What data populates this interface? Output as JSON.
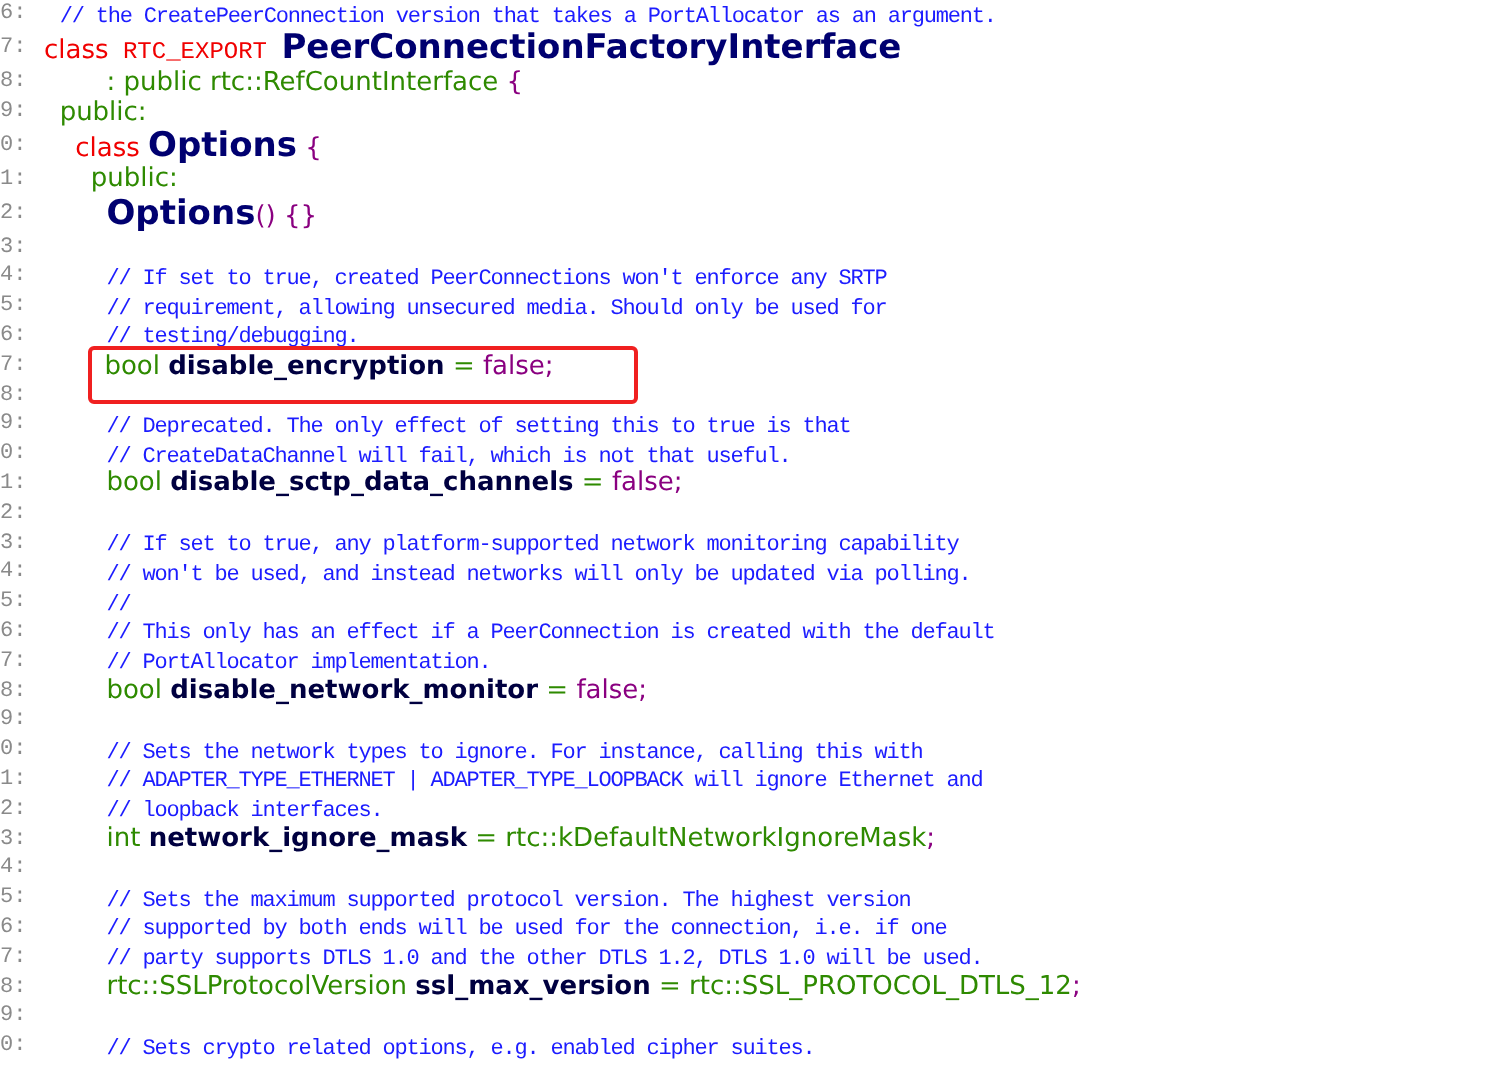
{
  "editor": {
    "lines": [
      {
        "number": "6:",
        "tokens": [
          {
            "kind": "comment",
            "text": " // the CreatePeerConnection version that takes a PortAllocator as an argument."
          }
        ]
      },
      {
        "number": "7:",
        "tokens": [
          {
            "kind": "keyword",
            "text": "class"
          },
          {
            "kind": "macro",
            "text": " RTC_EXPORT "
          },
          {
            "kind": "classname",
            "text": "PeerConnectionFactoryInterface"
          }
        ]
      },
      {
        "number": "8:",
        "tokens": [
          {
            "kind": "type",
            "text": "    : public rtc::RefCountInterface "
          },
          {
            "kind": "punct",
            "text": "{"
          }
        ]
      },
      {
        "number": "9:",
        "tokens": [
          {
            "kind": "type",
            "text": " public:"
          }
        ]
      },
      {
        "number": "0:",
        "tokens": [
          {
            "kind": "keyword",
            "text": "  class "
          },
          {
            "kind": "classname",
            "text": "Options"
          },
          {
            "kind": "punct",
            "text": " {"
          }
        ]
      },
      {
        "number": "1:",
        "tokens": [
          {
            "kind": "type",
            "text": "   public:"
          }
        ]
      },
      {
        "number": "2:",
        "tokens": [
          {
            "kind": "classname",
            "text": "    Options"
          },
          {
            "kind": "punct",
            "text": "() {}"
          }
        ]
      },
      {
        "number": "3:"
      },
      {
        "number": "4:",
        "tokens": [
          {
            "kind": "comment",
            "text": "    // If set to true, created PeerConnections won't enforce any SRTP"
          }
        ]
      },
      {
        "number": "5:",
        "tokens": [
          {
            "kind": "comment",
            "text": "    // requirement, allowing unsecured media. Should only be used for"
          }
        ]
      },
      {
        "number": "6:",
        "tokens": [
          {
            "kind": "comment",
            "text": "    // testing/debugging."
          }
        ]
      },
      {
        "number": "7:",
        "highlighted": true,
        "tokens": [
          {
            "kind": "type",
            "text": "    bool "
          },
          {
            "kind": "ident",
            "text": "disable_encryption"
          },
          {
            "kind": "op",
            "text": " = "
          },
          {
            "kind": "literal",
            "text": "false;"
          }
        ]
      },
      {
        "number": "8:"
      },
      {
        "number": "9:",
        "tokens": [
          {
            "kind": "comment",
            "text": "    // Deprecated. The only effect of setting this to true is that"
          }
        ]
      },
      {
        "number": "0:",
        "tokens": [
          {
            "kind": "comment",
            "text": "    // CreateDataChannel will fail, which is not that useful."
          }
        ]
      },
      {
        "number": "1:",
        "tokens": [
          {
            "kind": "type",
            "text": "    bool "
          },
          {
            "kind": "ident",
            "text": "disable_sctp_data_channels"
          },
          {
            "kind": "op",
            "text": " = "
          },
          {
            "kind": "literal",
            "text": "false;"
          }
        ]
      },
      {
        "number": "2:"
      },
      {
        "number": "3:",
        "tokens": [
          {
            "kind": "comment",
            "text": "    // If set to true, any platform-supported network monitoring capability"
          }
        ]
      },
      {
        "number": "4:",
        "tokens": [
          {
            "kind": "comment",
            "text": "    // won't be used, and instead networks will only be updated via polling."
          }
        ]
      },
      {
        "number": "5:",
        "tokens": [
          {
            "kind": "comment",
            "text": "    //"
          }
        ]
      },
      {
        "number": "6:",
        "tokens": [
          {
            "kind": "comment",
            "text": "    // This only has an effect if a PeerConnection is created with the default"
          }
        ]
      },
      {
        "number": "7:",
        "tokens": [
          {
            "kind": "comment",
            "text": "    // PortAllocator implementation."
          }
        ]
      },
      {
        "number": "8:",
        "tokens": [
          {
            "kind": "type",
            "text": "    bool "
          },
          {
            "kind": "ident",
            "text": "disable_network_monitor"
          },
          {
            "kind": "op",
            "text": " = "
          },
          {
            "kind": "literal",
            "text": "false;"
          }
        ]
      },
      {
        "number": "9:"
      },
      {
        "number": "0:",
        "tokens": [
          {
            "kind": "comment",
            "text": "    // Sets the network types to ignore. For instance, calling this with"
          }
        ]
      },
      {
        "number": "1:",
        "tokens": [
          {
            "kind": "comment",
            "text": "    // ADAPTER_TYPE_ETHERNET | ADAPTER_TYPE_LOOPBACK will ignore Ethernet and"
          }
        ]
      },
      {
        "number": "2:",
        "tokens": [
          {
            "kind": "comment",
            "text": "    // loopback interfaces."
          }
        ]
      },
      {
        "number": "3:",
        "tokens": [
          {
            "kind": "type",
            "text": "    int "
          },
          {
            "kind": "ident",
            "text": "network_ignore_mask"
          },
          {
            "kind": "op",
            "text": " = "
          },
          {
            "kind": "type",
            "text": "rtc::kDefaultNetworkIgnoreMask"
          },
          {
            "kind": "punct",
            "text": ";"
          }
        ]
      },
      {
        "number": "4:"
      },
      {
        "number": "5:",
        "tokens": [
          {
            "kind": "comment",
            "text": "    // Sets the maximum supported protocol version. The highest version"
          }
        ]
      },
      {
        "number": "6:",
        "tokens": [
          {
            "kind": "comment",
            "text": "    // supported by both ends will be used for the connection, i.e. if one"
          }
        ]
      },
      {
        "number": "7:",
        "tokens": [
          {
            "kind": "comment",
            "text": "    // party supports DTLS 1.0 and the other DTLS 1.2, DTLS 1.0 will be used."
          }
        ]
      },
      {
        "number": "8:",
        "tokens": [
          {
            "kind": "type",
            "text": "    rtc::SSLProtocolVersion "
          },
          {
            "kind": "ident",
            "text": "ssl_max_version"
          },
          {
            "kind": "op",
            "text": " = "
          },
          {
            "kind": "type",
            "text": "rtc::SSL_PROTOCOL_DTLS_12"
          },
          {
            "kind": "punct",
            "text": ";"
          }
        ]
      },
      {
        "number": "9:"
      },
      {
        "number": "0:",
        "tokens": [
          {
            "kind": "comment",
            "text": "    // Sets crypto related options, e.g. enabled cipher suites."
          }
        ]
      }
    ]
  }
}
